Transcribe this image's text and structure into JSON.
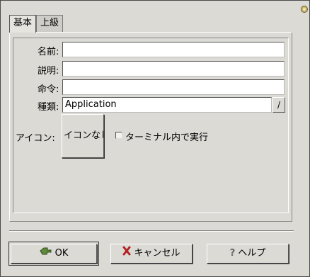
{
  "tabs": [
    {
      "label": "基本",
      "active": true
    },
    {
      "label": "上級",
      "active": false
    }
  ],
  "form": {
    "name_label": "名前:",
    "name_value": "",
    "comment_label": "説明:",
    "comment_value": "",
    "command_label": "命令:",
    "command_value": "",
    "type_label": "種類:",
    "type_value": "Application",
    "icon_label": "アイコン:",
    "icon_button_label": "イコンなし",
    "terminal_label": "ターミナル内で実行",
    "terminal_checked": false
  },
  "buttons": {
    "ok": "OK",
    "cancel": "キャンセル",
    "help": "ヘルプ"
  },
  "colors": {
    "window_bg": "#dcdad5",
    "ok_icon": "#5f8a3a",
    "cancel_icon": "#b22222"
  }
}
